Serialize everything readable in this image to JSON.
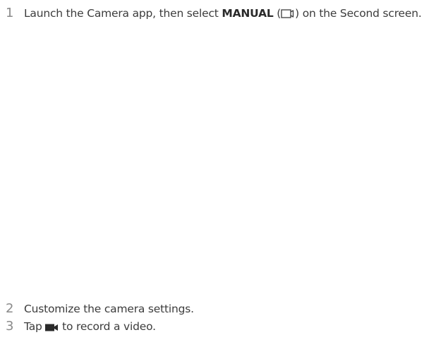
{
  "steps": [
    {
      "number": "1",
      "text_before": "Launch the Camera app, then select ",
      "bold": "MANUAL",
      "paren_open": " (",
      "icon": "manual-video-mode-icon",
      "paren_close": ")",
      "text_after": " on the Second screen."
    },
    {
      "number": "2",
      "text": "Customize the camera settings."
    },
    {
      "number": "3",
      "text_before": "Tap ",
      "icon": "record-video-icon",
      "text_after": " to record a video."
    }
  ],
  "colors": {
    "text": "#3c3c3c",
    "step_number": "#8a8a8a"
  }
}
